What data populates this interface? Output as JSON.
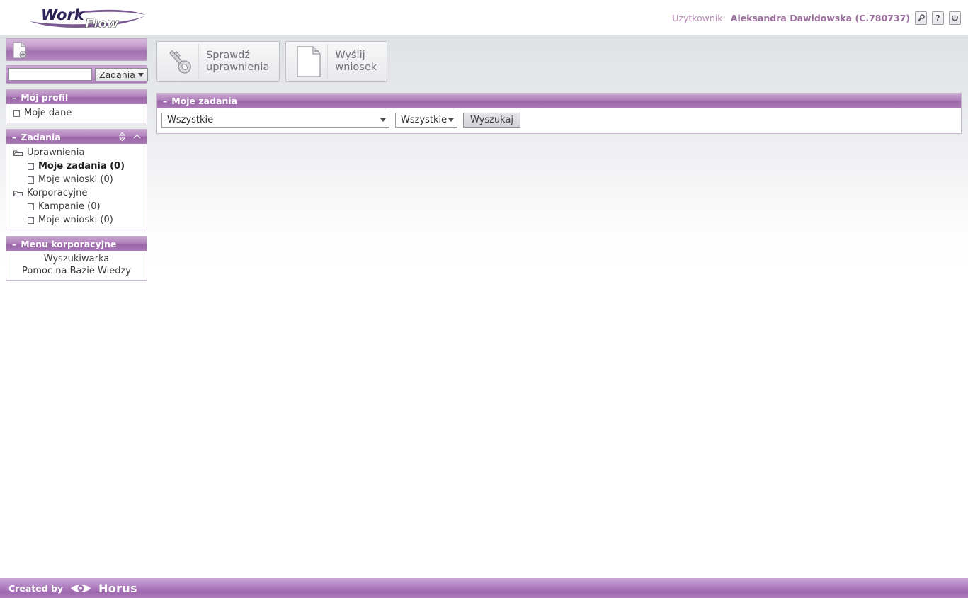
{
  "brand": {
    "logo_word1": "Work",
    "logo_word2": "Flow",
    "accent_purple": "#9a66a8",
    "panel_header_purple": "#b083bb"
  },
  "header": {
    "user_label": "Użytkownik:",
    "user_name": "Aleksandra Dawidowska (C.780737)",
    "buttons": [
      {
        "name": "key-icon",
        "label": ""
      },
      {
        "name": "help-icon",
        "label": "?"
      },
      {
        "name": "power-icon",
        "label": ""
      }
    ]
  },
  "sidebar": {
    "new_document_icon": "new-document-icon",
    "search": {
      "value": "",
      "placeholder": ""
    },
    "scope_dropdown": {
      "label": "Zadania"
    },
    "panels": [
      {
        "title": "Mój profil",
        "collapse_dash": "–",
        "items": [
          {
            "label": "Moje dane",
            "type": "leaf",
            "icon": "page-icon",
            "bold": false,
            "indent": false
          }
        ]
      },
      {
        "title": "Zadania",
        "collapse_dash": "–",
        "has_head_icons": true,
        "items": [
          {
            "label": "Uprawnienia",
            "type": "node",
            "icon": "folder-icon",
            "bold": false,
            "indent": false
          },
          {
            "label": "Moje zadania (0)",
            "type": "leaf",
            "icon": "page-icon",
            "bold": true,
            "indent": true
          },
          {
            "label": "Moje wnioski (0)",
            "type": "leaf",
            "icon": "page-icon",
            "bold": false,
            "indent": true
          },
          {
            "label": "Korporacyjne",
            "type": "node",
            "icon": "folder-icon",
            "bold": false,
            "indent": false
          },
          {
            "label": "Kampanie (0)",
            "type": "leaf",
            "icon": "page-icon",
            "bold": false,
            "indent": true
          },
          {
            "label": "Moje wnioski (0)",
            "type": "leaf",
            "icon": "page-icon",
            "bold": false,
            "indent": true
          }
        ]
      },
      {
        "title": "Menu korporacyjne",
        "collapse_dash": "–",
        "links": [
          {
            "label": "Wyszukiwarka"
          },
          {
            "label": "Pomoc na Bazie Wiedzy"
          }
        ]
      }
    ]
  },
  "actions": [
    {
      "icon": "key-icon",
      "label": "Sprawdź\nuprawnienia"
    },
    {
      "icon": "document-icon",
      "label": "Wyślij\nwniosek"
    }
  ],
  "main": {
    "panel_title": "Moje zadania",
    "collapse_dash": "–",
    "filter_primary": "Wszystkie",
    "filter_secondary": "Wszystkie",
    "search_button": "Wyszukaj"
  },
  "footer": {
    "created_by": "Created by",
    "company": "Horus",
    "logo_icon": "eye-icon"
  }
}
